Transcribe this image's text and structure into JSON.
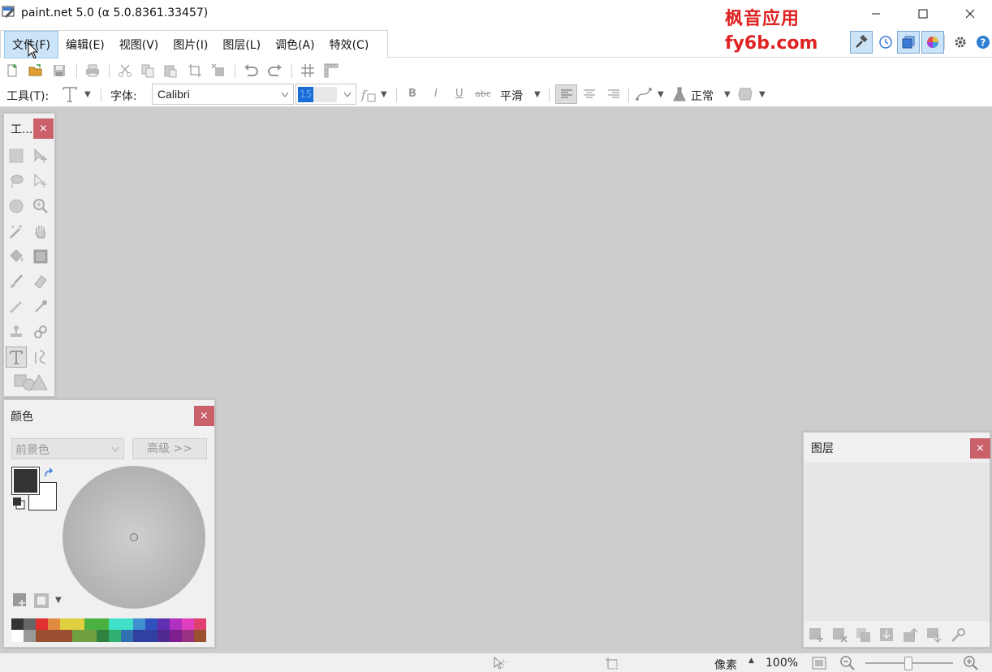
{
  "window": {
    "title": "paint.net 5.0 (α 5.0.8361.33457)",
    "minimize_icon": "minimize-icon",
    "maximize_icon": "maximize-icon",
    "close_icon": "close-icon"
  },
  "watermark": {
    "line1": "枫音应用",
    "line2": "fy6b.com",
    "color": "#e02222"
  },
  "menu": [
    {
      "label": "文件(F)",
      "active": true
    },
    {
      "label": "编辑(E)"
    },
    {
      "label": "视图(V)"
    },
    {
      "label": "图片(I)"
    },
    {
      "label": "图层(L)"
    },
    {
      "label": "调色(A)"
    },
    {
      "label": "特效(C)"
    }
  ],
  "toolbar2": {
    "tool_label": "工具(T):",
    "font_label": "字体:",
    "font_value": "Calibri",
    "size_value": "15",
    "smoothing": "平滑",
    "blend_mode": "正常",
    "bold": "B",
    "italic": "I",
    "underline": "U",
    "strike": "abc"
  },
  "tools_panel": {
    "title": "工..."
  },
  "colors_panel": {
    "title": "颜色",
    "target": "前景色",
    "advanced": "高级 >>",
    "primary_color": "#333333",
    "secondary_color": "#ffffff",
    "palette_row1": [
      "#333333",
      "#666666",
      "#e03030",
      "#e08a40",
      "#e0d040",
      "#e0d040",
      "#4ab040",
      "#4ab040",
      "#40e0c8",
      "#40e0c8",
      "#4090d0",
      "#3050c0",
      "#6030b0",
      "#b030c0",
      "#e040c0",
      "#e04070"
    ],
    "palette_row2": [
      "#ffffff",
      "#999999",
      "#9a5030",
      "#9a5030",
      "#9a5030",
      "#70a040",
      "#70a040",
      "#308040",
      "#30b070",
      "#3070b0",
      "#3040a0",
      "#3040a0",
      "#502a90",
      "#802090",
      "#9a3080",
      "#9a5030"
    ]
  },
  "layers_panel": {
    "title": "图层"
  },
  "status": {
    "units": "像素",
    "zoom": "100%"
  },
  "close_symbol": "×"
}
